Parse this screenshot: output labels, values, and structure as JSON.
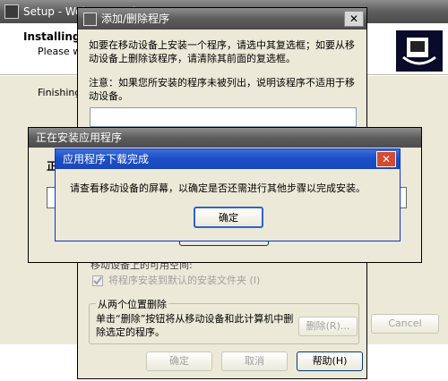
{
  "setup_window": {
    "title": "Setup - Wel... Co...  Pl...",
    "heading": "Installing",
    "subheading": "Please w...",
    "status": "Finishing",
    "cancel_label": "Cancel"
  },
  "add_remove_dialog": {
    "title": "添加/删除程序",
    "instructions": "如要在移动设备上安装一个程序，请选中其复选框；如要从移动设备上删除该程序，请清除其前面的复选框。",
    "note": "注意：如果您所安装的程序未被列出，说明该程序不适用于移动设备。",
    "available_space_label": "移动设备上的可用空间:",
    "default_folder_checkbox": "将程序安装到默认的安装文件夹 (I)",
    "remove_group_title": "从两个位置删除",
    "remove_group_text": "单击“删除”按钮将从移动设备和此计算机中删除选定的程序。",
    "remove_button": "删除(R)...",
    "ok_button": "确定",
    "cancel_button": "取消",
    "help_button": "帮助(H)"
  },
  "installing_dialog": {
    "title": "正在安装应用程序",
    "label": "正"
  },
  "download_complete_dialog": {
    "title": "应用程序下载完成",
    "message": "请查看移动设备的屏幕，以确定是否还需进行其他步骤以完成安装。",
    "ok_button": "确定"
  },
  "close_glyph": "✕",
  "colors": {
    "xp_blue": "#1c4fc7",
    "inactive_gray": "#5d5d5d",
    "window_bg": "#ece9d8",
    "close_red": "#d64a2e"
  }
}
